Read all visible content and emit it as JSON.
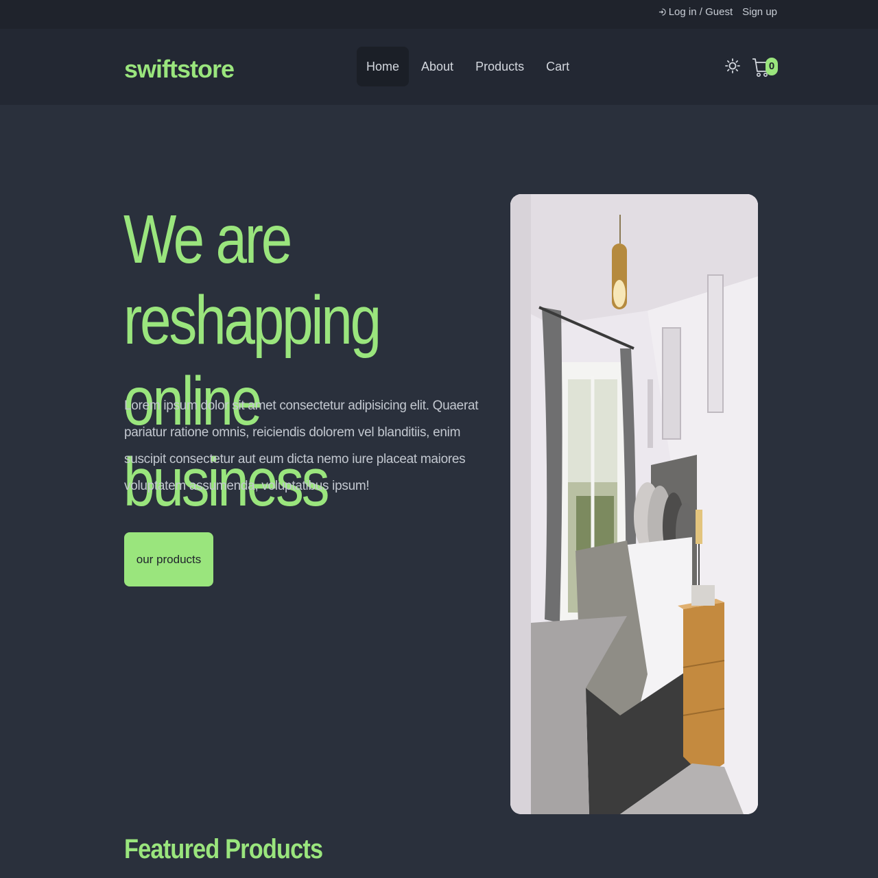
{
  "topbar": {
    "login_label": "Log in / Guest",
    "signup_label": "Sign up"
  },
  "navbar": {
    "logo": "swiftstore",
    "links": [
      {
        "label": "Home",
        "active": true
      },
      {
        "label": "About",
        "active": false
      },
      {
        "label": "Products",
        "active": false
      },
      {
        "label": "Cart",
        "active": false
      }
    ],
    "theme_icon": "sun-icon",
    "cart_icon": "cart-icon",
    "cart_count": "0"
  },
  "hero": {
    "title": "We are reshapping online business",
    "text": "Lorem ipsum dolor sit amet consectetur adipisicing elit. Quaerat pariatur ratione omnis, reiciendis dolorem vel blanditiis, enim suscipit consectetur aut eum dicta nemo iure placeat maiores voluptatem assumenda, voluptatibus ipsum!",
    "button_label": "our products"
  },
  "featured": {
    "title": "Featured Products"
  },
  "colors": {
    "accent": "#9ae57d",
    "background": "#2a303c",
    "topbar": "#1f232c",
    "navbar": "#232833"
  }
}
